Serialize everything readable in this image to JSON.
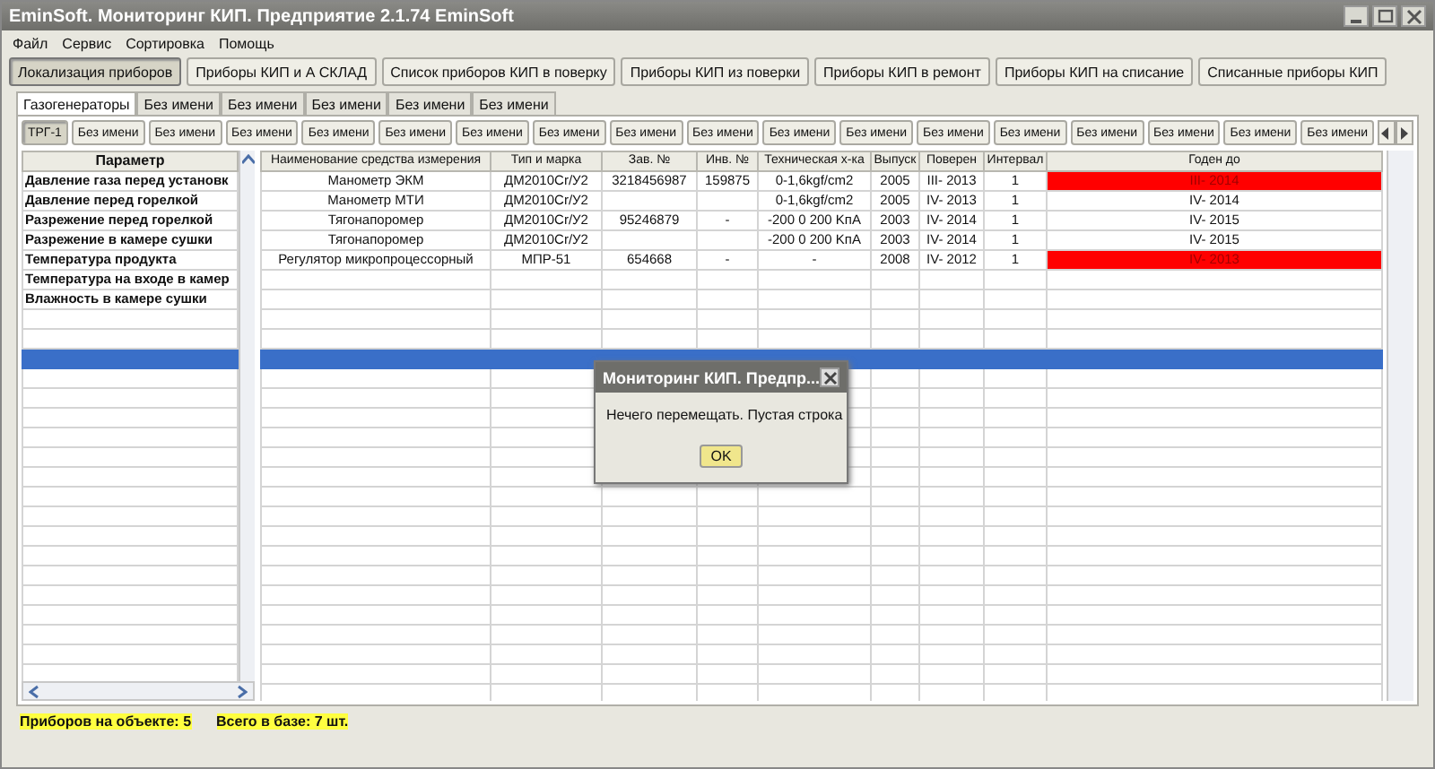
{
  "window": {
    "title": "EminSoft. Мониторинг КИП. Предприятие  2.1.74 EminSoft"
  },
  "menu": [
    "Файл",
    "Сервис",
    "Сортировка",
    "Помощь"
  ],
  "toolbar": [
    {
      "label": "Локализация приборов",
      "selected": true
    },
    {
      "label": "Приборы КИП и А  СКЛАД",
      "selected": false
    },
    {
      "label": "Список приборов КИП в поверку",
      "selected": false
    },
    {
      "label": "Приборы КИП из поверки",
      "selected": false
    },
    {
      "label": "Приборы КИП в ремонт",
      "selected": false
    },
    {
      "label": "Приборы КИП на списание",
      "selected": false
    },
    {
      "label": "Списанные приборы КИП",
      "selected": false
    }
  ],
  "group_tabs": [
    {
      "label": "Газогенераторы",
      "selected": true
    },
    {
      "label": "Без имени",
      "selected": false
    },
    {
      "label": "Без имени",
      "selected": false
    },
    {
      "label": "Без имени",
      "selected": false
    },
    {
      "label": "Без имени",
      "selected": false
    },
    {
      "label": "Без имени",
      "selected": false
    }
  ],
  "unit_tabs": [
    {
      "label": "ТРГ-1",
      "selected": true
    },
    {
      "label": "Без имени",
      "selected": false
    },
    {
      "label": "Без имени",
      "selected": false
    },
    {
      "label": "Без имени",
      "selected": false
    },
    {
      "label": "Без имени",
      "selected": false
    },
    {
      "label": "Без имени",
      "selected": false
    },
    {
      "label": "Без имени",
      "selected": false
    },
    {
      "label": "Без имени",
      "selected": false
    },
    {
      "label": "Без имени",
      "selected": false
    },
    {
      "label": "Без имени",
      "selected": false
    },
    {
      "label": "Без имени",
      "selected": false
    },
    {
      "label": "Без имени",
      "selected": false
    },
    {
      "label": "Без имени",
      "selected": false
    },
    {
      "label": "Без имени",
      "selected": false
    },
    {
      "label": "Без имени",
      "selected": false
    },
    {
      "label": "Без имени",
      "selected": false
    },
    {
      "label": "Без имени",
      "selected": false
    },
    {
      "label": "Без имени",
      "selected": false
    }
  ],
  "parameter_column": "Параметр",
  "columns": [
    "Наименование средства измерения",
    "Тип и марка",
    "Зав. №",
    "Инв. №",
    "Техническая х-ка",
    "Выпуск",
    "Поверен",
    "Интервал",
    "Годен до"
  ],
  "rows": [
    {
      "parameter": "Давление газа перед установк",
      "cells": [
        "Манометр ЭКМ",
        "ДМ2010Сr/У2",
        "3218456987",
        "159875",
        "0-1,6kgf/cm2",
        "2005",
        "III- 2013",
        "1",
        "III- 2014"
      ],
      "expired": true,
      "selected": false
    },
    {
      "parameter": "Давление перед горелкой",
      "cells": [
        "Манометр МТИ",
        "ДМ2010Сr/У2",
        "",
        "",
        "0-1,6kgf/cm2",
        "2005",
        "IV- 2013",
        "1",
        "IV- 2014"
      ],
      "expired": false,
      "selected": false
    },
    {
      "parameter": "Разрежение перед горелкой",
      "cells": [
        "Тягонапоромер",
        "ДМ2010Сr/У2",
        "95246879",
        "-",
        "-200 0 200 KпА",
        "2003",
        "IV- 2014",
        "1",
        "IV- 2015"
      ],
      "expired": false,
      "selected": false
    },
    {
      "parameter": "Разрежение в камере сушки",
      "cells": [
        "Тягонапоромер",
        "ДМ2010Сr/У2",
        "",
        "",
        "-200 0 200 KпА",
        "2003",
        "IV- 2014",
        "1",
        "IV- 2015"
      ],
      "expired": false,
      "selected": false
    },
    {
      "parameter": "Температура продукта",
      "cells": [
        "Регулятор микропроцессорный",
        "МПР-51",
        "654668",
        "-",
        "-",
        "2008",
        "IV- 2012",
        "1",
        "IV- 2013"
      ],
      "expired": true,
      "selected": false
    },
    {
      "parameter": "Температура на входе в камер",
      "selected": false
    },
    {
      "parameter": "Влажность в камере сушки",
      "selected": false
    },
    {
      "selected": false
    },
    {
      "selected": false
    },
    {
      "selected": true
    },
    {
      "selected": false
    },
    {
      "selected": false
    },
    {
      "selected": false
    },
    {
      "selected": false
    },
    {
      "selected": false
    },
    {
      "selected": false
    },
    {
      "selected": false
    },
    {
      "selected": false
    },
    {
      "selected": false
    },
    {
      "selected": false
    },
    {
      "selected": false
    },
    {
      "selected": false
    },
    {
      "selected": false
    },
    {
      "selected": false
    },
    {
      "selected": false
    },
    {
      "selected": false
    },
    {
      "selected": false
    }
  ],
  "status_bar": [
    "Приборов на объекте: 5",
    "Всего в базе: 7 шт."
  ],
  "dialog": {
    "title": "Мониторинг КИП. Предпр...",
    "message": "Нечего перемещать. Пустая строка",
    "button": "OK"
  }
}
